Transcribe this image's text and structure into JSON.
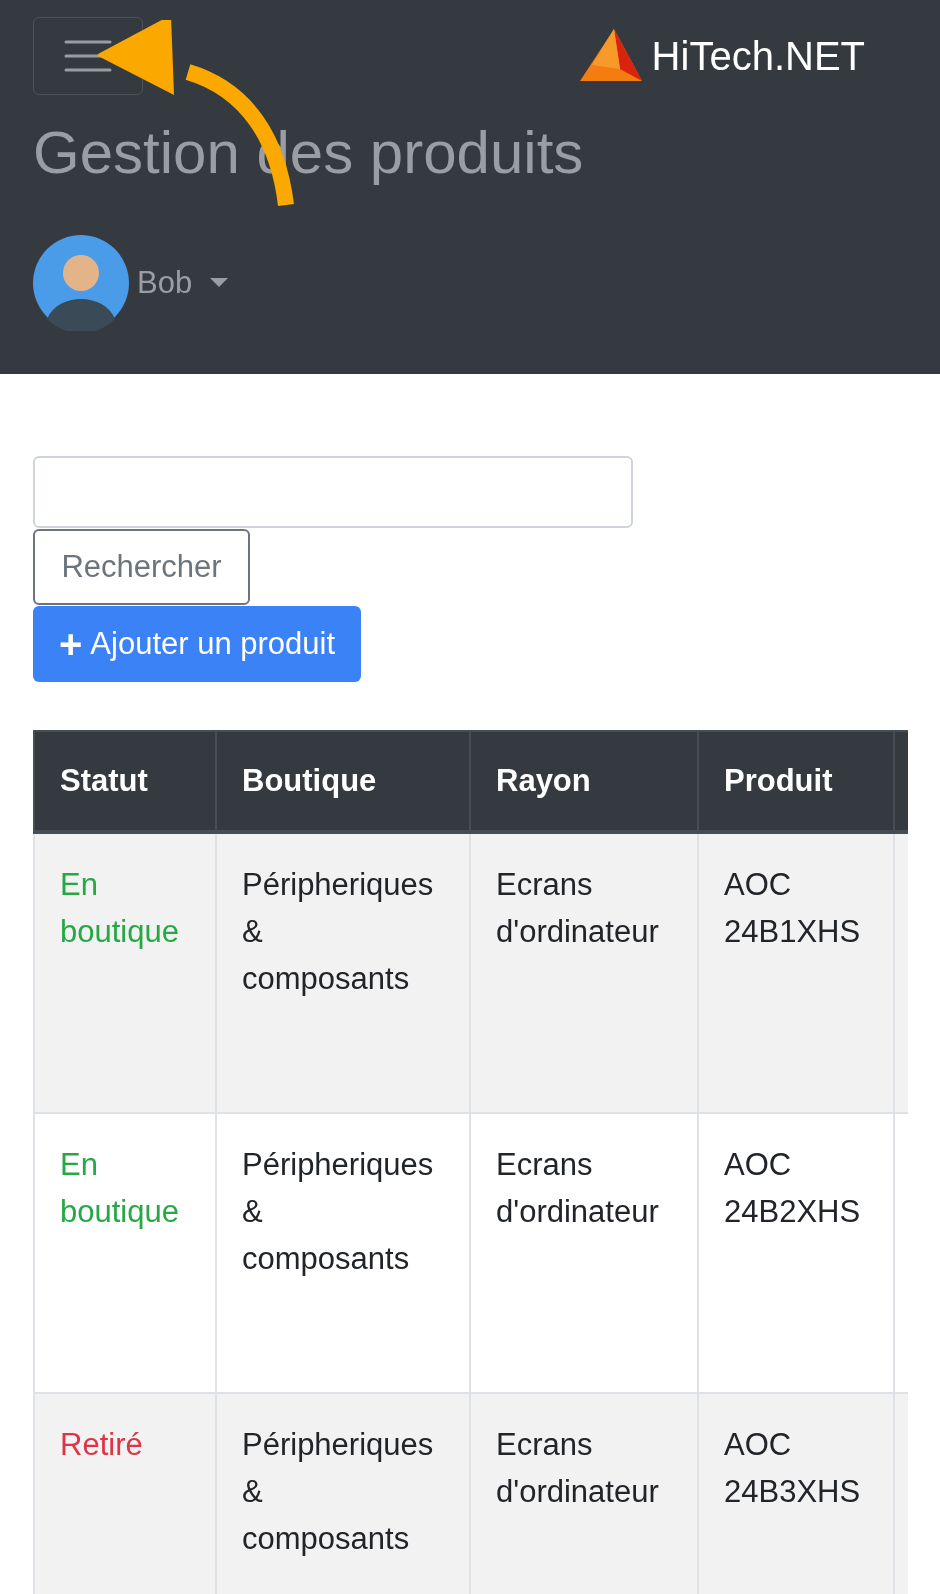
{
  "header": {
    "brand": "HiTech.NET",
    "title": "Gestion des produits",
    "user": {
      "name": "Bob"
    }
  },
  "search": {
    "button": "Rechercher"
  },
  "add_button": {
    "icon": "+",
    "label": "Ajouter un produit"
  },
  "table": {
    "columns": [
      "Statut",
      "Boutique",
      "Rayon",
      "Produit"
    ],
    "rows": [
      {
        "kind": "active",
        "cells": [
          "En boutique",
          "Péripheriques & composants",
          "Ecrans d'ordinateur",
          "AOC 24B1XHS"
        ]
      },
      {
        "kind": "active",
        "cells": [
          "En boutique",
          "Péripheriques & composants",
          "Ecrans d'ordinateur",
          "AOC 24B2XHS"
        ]
      },
      {
        "kind": "retired",
        "cells": [
          "Retiré",
          "Péripheriques & composants",
          "Ecrans d'ordinateur",
          "AOC 24B3XHS"
        ]
      }
    ]
  }
}
